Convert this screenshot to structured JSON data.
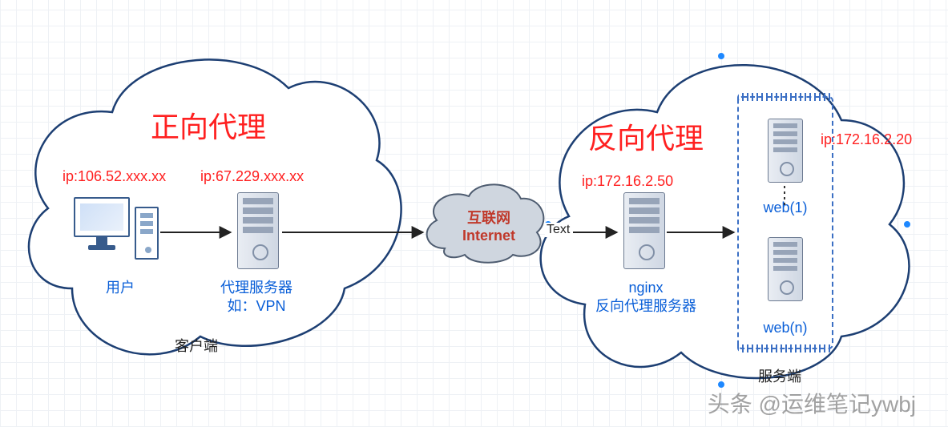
{
  "left_cloud": {
    "title": "正向代理",
    "user_ip": "ip:106.52.xxx.xx",
    "proxy_ip": "ip:67.229.xxx.xx",
    "user_label": "用户",
    "proxy_label_line1": "代理服务器",
    "proxy_label_line2": "如：VPN",
    "footer": "客户端"
  },
  "center": {
    "internet_line1": "互联网",
    "internet_line2": "Internet",
    "text_label": "Text"
  },
  "right_cloud": {
    "title": "反向代理",
    "nginx_ip": "ip:172.16.2.50",
    "web_ip": "ip:172.16.2.20",
    "nginx_label_line1": "nginx",
    "nginx_label_line2": "反向代理服务器",
    "web1_label": "web(1)",
    "webn_label": "web(n)",
    "footer": "服务端"
  },
  "watermark": "头条 @运维笔记ywbj"
}
